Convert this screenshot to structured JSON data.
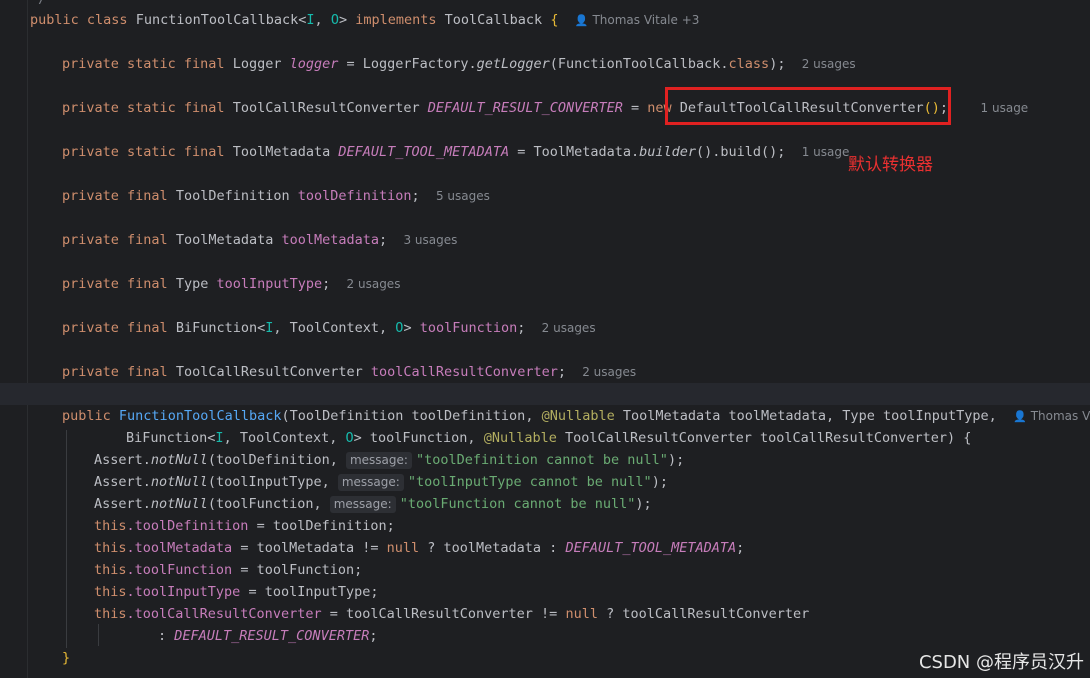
{
  "editor": {
    "top_fragment": "*/",
    "class_decl": {
      "kw_public": "public",
      "kw_class": "class",
      "name": "FunctionToolCallback",
      "generics_open": "<",
      "generic_i": "I",
      "generic_sep": ", ",
      "generic_o": "O",
      "generics_close": ">",
      "kw_implements": "implements",
      "interface": "ToolCallback",
      "brace": "{",
      "author": "Thomas Vitale +3"
    },
    "fields": [
      {
        "mods": "private static final",
        "type": "Logger",
        "name": "logger",
        "init_pre": " = LoggerFactory.",
        "init_call": "getLogger",
        "init_post": "(FunctionToolCallback.",
        "init_kw": "class",
        "init_end": ");",
        "usages": "2 usages"
      },
      {
        "mods": "private static final",
        "type": "ToolCallResultConverter",
        "name": "DEFAULT_RESULT_CONVERTER",
        "assign": " = ",
        "kw_new": "new",
        "init": " DefaultToolCallResultConverter",
        "init_parens": "()",
        "init_end": ";",
        "usages": "1 usage"
      },
      {
        "mods": "private static final",
        "type": "ToolMetadata",
        "name": "DEFAULT_TOOL_METADATA",
        "init_pre": " = ToolMetadata.",
        "init_call": "builder",
        "init_post": "().build();",
        "usages": "1 usage"
      },
      {
        "mods": "private final",
        "type": "ToolDefinition",
        "name": "toolDefinition",
        "usages": "5 usages"
      },
      {
        "mods": "private final",
        "type": "ToolMetadata",
        "name": "toolMetadata",
        "usages": "3 usages"
      },
      {
        "mods": "private final",
        "type": "Type",
        "name": "toolInputType",
        "usages": "2 usages"
      },
      {
        "mods": "private final",
        "type_pre": "BiFunction",
        "type_lt": "<",
        "type_i": "I",
        "type_mid": ", ToolContext, ",
        "type_o": "O",
        "type_gt": ">",
        "name": "toolFunction",
        "usages": "2 usages"
      },
      {
        "mods": "private final",
        "type": "ToolCallResultConverter",
        "name": "toolCallResultConverter",
        "usages": "2 usages"
      }
    ],
    "constructor": {
      "kw_public": "public",
      "name": "FunctionToolCallback",
      "params_line1_a": "(ToolDefinition toolDefinition, ",
      "nullable": "@Nullable",
      "params_line1_b": " ToolMetadata toolMetadata, Type toolInputType,",
      "author": "Thomas Vitale",
      "params_line2_a": "BiFunction",
      "params_line2_lt": "<",
      "params_line2_i": "I",
      "params_line2_mid": ", ToolContext, ",
      "params_line2_o": "O",
      "params_line2_gt": ">",
      "params_line2_b": " toolFunction, ",
      "params_line2_nullable": "@Nullable",
      "params_line2_c": " ToolCallResultConverter toolCallResultConverter) {",
      "asserts": [
        {
          "pre": "Assert.",
          "call": "notNull",
          "arg": "(toolDefinition, ",
          "hint": "message:",
          "msg": "\"toolDefinition cannot be null\"",
          "end": ");"
        },
        {
          "pre": "Assert.",
          "call": "notNull",
          "arg": "(toolInputType, ",
          "hint": "message:",
          "msg": "\"toolInputType cannot be null\"",
          "end": ");"
        },
        {
          "pre": "Assert.",
          "call": "notNull",
          "arg": "(toolFunction, ",
          "hint": "message:",
          "msg": "\"toolFunction cannot be null\"",
          "end": ");"
        }
      ],
      "assignments": [
        {
          "this": "this",
          "field": ".toolDefinition",
          "rest": " = toolDefinition;"
        },
        {
          "this": "this",
          "field": ".toolMetadata",
          "rest_a": " = toolMetadata != ",
          "null": "null",
          "rest_b": " ? toolMetadata : ",
          "const": "DEFAULT_TOOL_METADATA",
          "end": ";"
        },
        {
          "this": "this",
          "field": ".toolFunction",
          "rest": " = toolFunction;"
        },
        {
          "this": "this",
          "field": ".toolInputType",
          "rest": " = toolInputType;"
        },
        {
          "this": "this",
          "field": ".toolCallResultConverter",
          "rest_a": " = toolCallResultConverter != ",
          "null": "null",
          "rest_b": " ? toolCallResultConverter"
        }
      ],
      "continuation_a": ": ",
      "continuation_const": "DEFAULT_RESULT_CONVERTER",
      "continuation_end": ";",
      "close": "}"
    }
  },
  "annotation_note": "默认转换器",
  "watermark": "CSDN @程序员汉升",
  "colors": {
    "keyword": "#cf8e6d",
    "field": "#c77dbb",
    "method": "#56a8f5",
    "type_param": "#16baac",
    "annotation": "#b3ae60",
    "string": "#6aab73",
    "highlight_box": "#e02121"
  }
}
